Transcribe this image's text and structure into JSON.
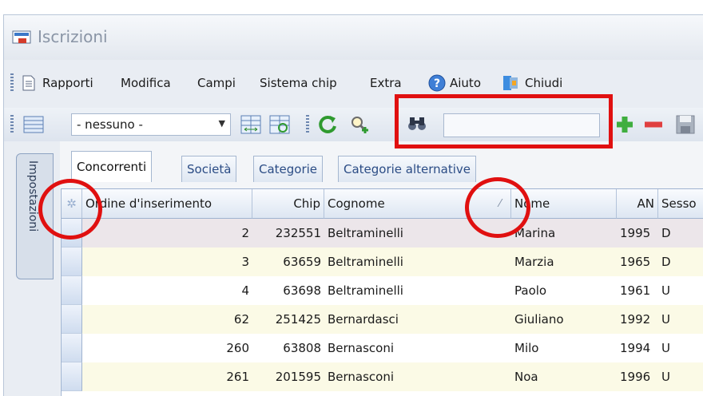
{
  "window": {
    "title": "Iscrizioni"
  },
  "menu": {
    "items": [
      {
        "label": "Rapporti"
      },
      {
        "label": "Modifica"
      },
      {
        "label": "Campi"
      },
      {
        "label": "Sistema chip"
      },
      {
        "label": "Extra"
      },
      {
        "label": "Aiuto",
        "icon": "help-icon"
      },
      {
        "label": "Chiudi",
        "icon": "close-door-icon"
      }
    ]
  },
  "toolbar": {
    "filter_value": "- nessuno -",
    "search_value": ""
  },
  "side_tab": {
    "label": "Impostazioni"
  },
  "tabs": [
    {
      "label": "Concorrenti",
      "active": true
    },
    {
      "label": "Società"
    },
    {
      "label": "Categorie"
    },
    {
      "label": "Categorie alternative"
    }
  ],
  "table": {
    "columns": [
      "Ordine d'inserimento",
      "Chip",
      "Cognome",
      "Nome",
      "AN",
      "Sesso"
    ],
    "rows": [
      {
        "ordine": "2",
        "chip": "232551",
        "cognome": "Beltraminelli",
        "nome": "Marina",
        "an": "1995",
        "sesso": "D"
      },
      {
        "ordine": "3",
        "chip": "63659",
        "cognome": "Beltraminelli",
        "nome": "Marzia",
        "an": "1965",
        "sesso": "D"
      },
      {
        "ordine": "4",
        "chip": "63698",
        "cognome": "Beltraminelli",
        "nome": "Paolo",
        "an": "1961",
        "sesso": "U"
      },
      {
        "ordine": "62",
        "chip": "251425",
        "cognome": "Bernardasci",
        "nome": "Giuliano",
        "an": "1992",
        "sesso": "U"
      },
      {
        "ordine": "260",
        "chip": "63808",
        "cognome": "Bernasconi",
        "nome": "Milo",
        "an": "1994",
        "sesso": "U"
      },
      {
        "ordine": "261",
        "chip": "201595",
        "cognome": "Bernasconi",
        "nome": "Noa",
        "an": "1996",
        "sesso": "U"
      }
    ]
  },
  "colors": {
    "highlight": "#e01010",
    "row_alt": "#fbfae6",
    "row_selected": "#ece6ea",
    "accent": "#2b4c85"
  }
}
